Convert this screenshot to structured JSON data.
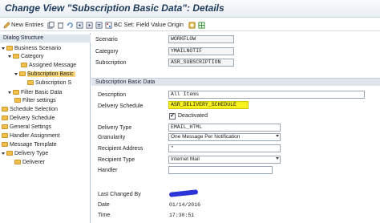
{
  "window": {
    "title": "Change View \"Subscription Basic Data\": Details"
  },
  "toolbar": {
    "new_entries_label": "New Entries",
    "bc_set_label": "BC Set: Field Value Origin"
  },
  "sidebar": {
    "header": "Dialog Structure",
    "items": [
      {
        "label": "Business Scenario"
      },
      {
        "label": "Category"
      },
      {
        "label": "Assigned Message"
      },
      {
        "label": "Subscription Basic"
      },
      {
        "label": "Subscription S"
      },
      {
        "label": "Filter Basic Data"
      },
      {
        "label": "Filter settings"
      },
      {
        "label": "Schedule Selection"
      },
      {
        "label": "Delivery Schedule"
      },
      {
        "label": "General Settings"
      },
      {
        "label": "Handler Assignment"
      },
      {
        "label": "Message Template"
      },
      {
        "label": "Delivery Type"
      },
      {
        "label": "Deliverer"
      }
    ]
  },
  "header_fields": {
    "scenario_label": "Scenario",
    "scenario_value": "WORKFLOW",
    "category_label": "Category",
    "category_value": "YMAILNOTIF",
    "subscription_label": "Subscription",
    "subscription_value": "ASR_SUBSCRIPTION"
  },
  "group": {
    "title": "Subscription Basic Data",
    "description_label": "Description",
    "description_value": "All Items",
    "delivery_schedule_label": "Delivery Schedule",
    "delivery_schedule_value": "ASR_DELIVERY_SCHEDULE",
    "deactivated_label": "Deactivated",
    "deactivated_checked": "✔",
    "delivery_type_label": "Delivery Type",
    "delivery_type_value": "EMAIL_HTML",
    "granularity_label": "Granularity",
    "granularity_value": "One Message Per Notification",
    "recipient_address_label": "Recipient Address",
    "recipient_address_value": "*",
    "recipient_type_label": "Recipient Type",
    "recipient_type_value": "Internet Mail",
    "handler_label": "Handler",
    "handler_value": "",
    "last_changed_by_label": "Last Changed By",
    "date_label": "Date",
    "date_value": "01/14/2016",
    "time_label": "Time",
    "time_value": "17:30:51"
  },
  "colors": {
    "title": "#1d3a5a",
    "highlight": "#f7f21d",
    "selected_tree": "#f9d77a",
    "folder": "#f1c04a"
  }
}
